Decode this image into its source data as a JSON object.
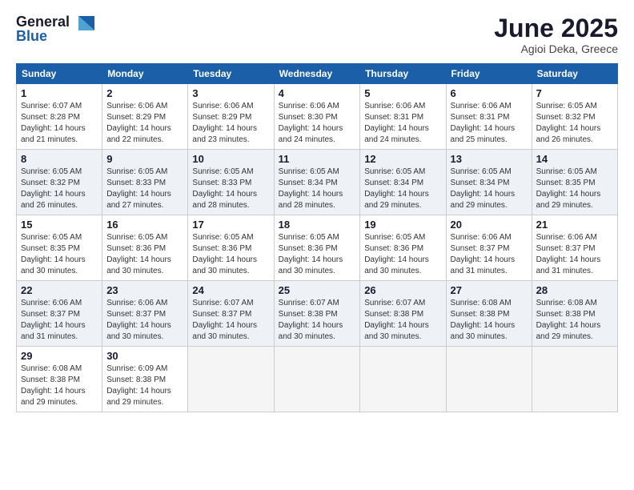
{
  "logo": {
    "general": "General",
    "blue": "Blue"
  },
  "title": "June 2025",
  "location": "Agioi Deka, Greece",
  "days_of_week": [
    "Sunday",
    "Monday",
    "Tuesday",
    "Wednesday",
    "Thursday",
    "Friday",
    "Saturday"
  ],
  "weeks": [
    [
      {
        "day": "1",
        "sunrise": "6:07 AM",
        "sunset": "8:28 PM",
        "daylight": "14 hours and 21 minutes."
      },
      {
        "day": "2",
        "sunrise": "6:06 AM",
        "sunset": "8:29 PM",
        "daylight": "14 hours and 22 minutes."
      },
      {
        "day": "3",
        "sunrise": "6:06 AM",
        "sunset": "8:29 PM",
        "daylight": "14 hours and 23 minutes."
      },
      {
        "day": "4",
        "sunrise": "6:06 AM",
        "sunset": "8:30 PM",
        "daylight": "14 hours and 24 minutes."
      },
      {
        "day": "5",
        "sunrise": "6:06 AM",
        "sunset": "8:31 PM",
        "daylight": "14 hours and 24 minutes."
      },
      {
        "day": "6",
        "sunrise": "6:06 AM",
        "sunset": "8:31 PM",
        "daylight": "14 hours and 25 minutes."
      },
      {
        "day": "7",
        "sunrise": "6:05 AM",
        "sunset": "8:32 PM",
        "daylight": "14 hours and 26 minutes."
      }
    ],
    [
      {
        "day": "8",
        "sunrise": "6:05 AM",
        "sunset": "8:32 PM",
        "daylight": "14 hours and 26 minutes."
      },
      {
        "day": "9",
        "sunrise": "6:05 AM",
        "sunset": "8:33 PM",
        "daylight": "14 hours and 27 minutes."
      },
      {
        "day": "10",
        "sunrise": "6:05 AM",
        "sunset": "8:33 PM",
        "daylight": "14 hours and 28 minutes."
      },
      {
        "day": "11",
        "sunrise": "6:05 AM",
        "sunset": "8:34 PM",
        "daylight": "14 hours and 28 minutes."
      },
      {
        "day": "12",
        "sunrise": "6:05 AM",
        "sunset": "8:34 PM",
        "daylight": "14 hours and 29 minutes."
      },
      {
        "day": "13",
        "sunrise": "6:05 AM",
        "sunset": "8:34 PM",
        "daylight": "14 hours and 29 minutes."
      },
      {
        "day": "14",
        "sunrise": "6:05 AM",
        "sunset": "8:35 PM",
        "daylight": "14 hours and 29 minutes."
      }
    ],
    [
      {
        "day": "15",
        "sunrise": "6:05 AM",
        "sunset": "8:35 PM",
        "daylight": "14 hours and 30 minutes."
      },
      {
        "day": "16",
        "sunrise": "6:05 AM",
        "sunset": "8:36 PM",
        "daylight": "14 hours and 30 minutes."
      },
      {
        "day": "17",
        "sunrise": "6:05 AM",
        "sunset": "8:36 PM",
        "daylight": "14 hours and 30 minutes."
      },
      {
        "day": "18",
        "sunrise": "6:05 AM",
        "sunset": "8:36 PM",
        "daylight": "14 hours and 30 minutes."
      },
      {
        "day": "19",
        "sunrise": "6:05 AM",
        "sunset": "8:36 PM",
        "daylight": "14 hours and 30 minutes."
      },
      {
        "day": "20",
        "sunrise": "6:06 AM",
        "sunset": "8:37 PM",
        "daylight": "14 hours and 31 minutes."
      },
      {
        "day": "21",
        "sunrise": "6:06 AM",
        "sunset": "8:37 PM",
        "daylight": "14 hours and 31 minutes."
      }
    ],
    [
      {
        "day": "22",
        "sunrise": "6:06 AM",
        "sunset": "8:37 PM",
        "daylight": "14 hours and 31 minutes."
      },
      {
        "day": "23",
        "sunrise": "6:06 AM",
        "sunset": "8:37 PM",
        "daylight": "14 hours and 30 minutes."
      },
      {
        "day": "24",
        "sunrise": "6:07 AM",
        "sunset": "8:37 PM",
        "daylight": "14 hours and 30 minutes."
      },
      {
        "day": "25",
        "sunrise": "6:07 AM",
        "sunset": "8:38 PM",
        "daylight": "14 hours and 30 minutes."
      },
      {
        "day": "26",
        "sunrise": "6:07 AM",
        "sunset": "8:38 PM",
        "daylight": "14 hours and 30 minutes."
      },
      {
        "day": "27",
        "sunrise": "6:08 AM",
        "sunset": "8:38 PM",
        "daylight": "14 hours and 30 minutes."
      },
      {
        "day": "28",
        "sunrise": "6:08 AM",
        "sunset": "8:38 PM",
        "daylight": "14 hours and 29 minutes."
      }
    ],
    [
      {
        "day": "29",
        "sunrise": "6:08 AM",
        "sunset": "8:38 PM",
        "daylight": "14 hours and 29 minutes."
      },
      {
        "day": "30",
        "sunrise": "6:09 AM",
        "sunset": "8:38 PM",
        "daylight": "14 hours and 29 minutes."
      },
      null,
      null,
      null,
      null,
      null
    ]
  ],
  "labels": {
    "sunrise": "Sunrise:",
    "sunset": "Sunset:",
    "daylight": "Daylight:"
  }
}
